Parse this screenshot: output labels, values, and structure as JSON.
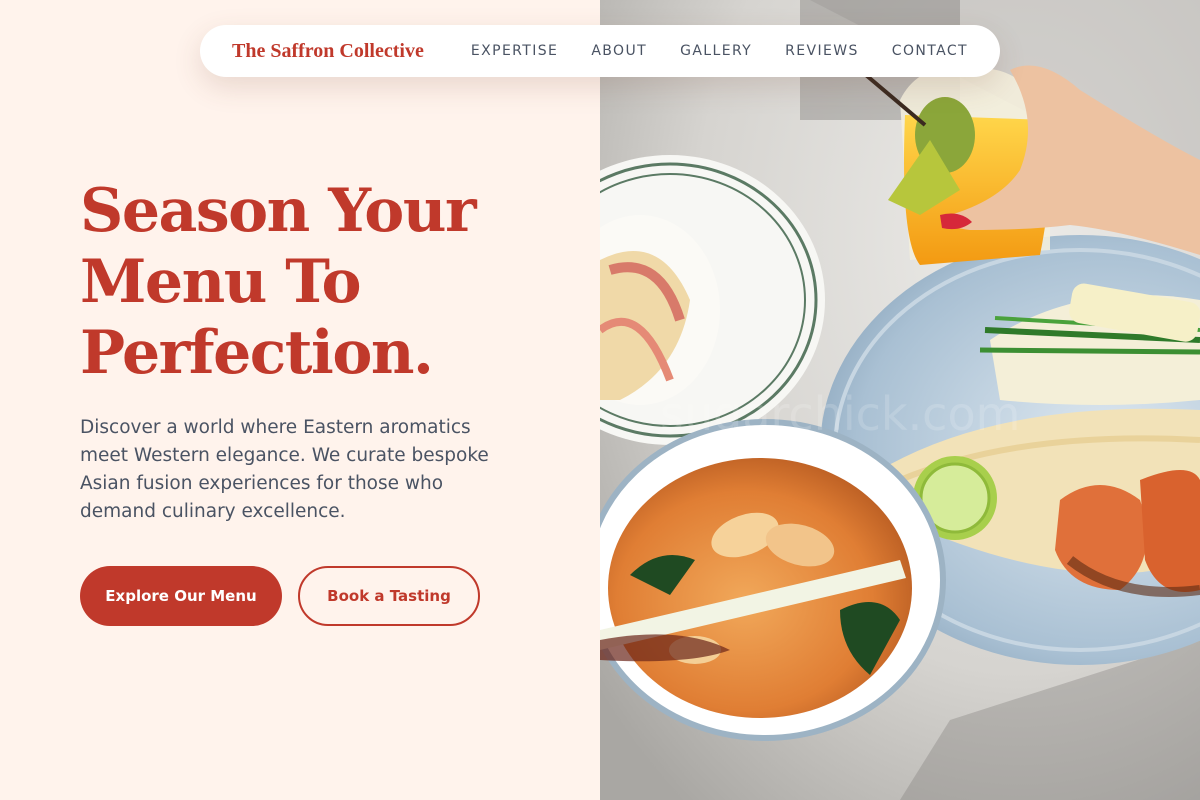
{
  "nav": {
    "brand": "The Saffron Collective",
    "links": [
      {
        "label": "EXPERTISE"
      },
      {
        "label": "ABOUT"
      },
      {
        "label": "GALLERY"
      },
      {
        "label": "REVIEWS"
      },
      {
        "label": "CONTACT"
      }
    ]
  },
  "hero": {
    "title_lines": [
      "Season Your",
      "Menu To",
      "Perfection."
    ],
    "description": "Discover a world where Eastern aromatics meet Western elegance. We curate bespoke Asian fusion experiences for those who demand culinary excellence.",
    "primary_button": "Explore Our Menu",
    "secondary_button": "Book a Tasting"
  },
  "colors": {
    "accent": "#c0392b",
    "background": "#fff3ec",
    "body_text": "#4a5363"
  }
}
